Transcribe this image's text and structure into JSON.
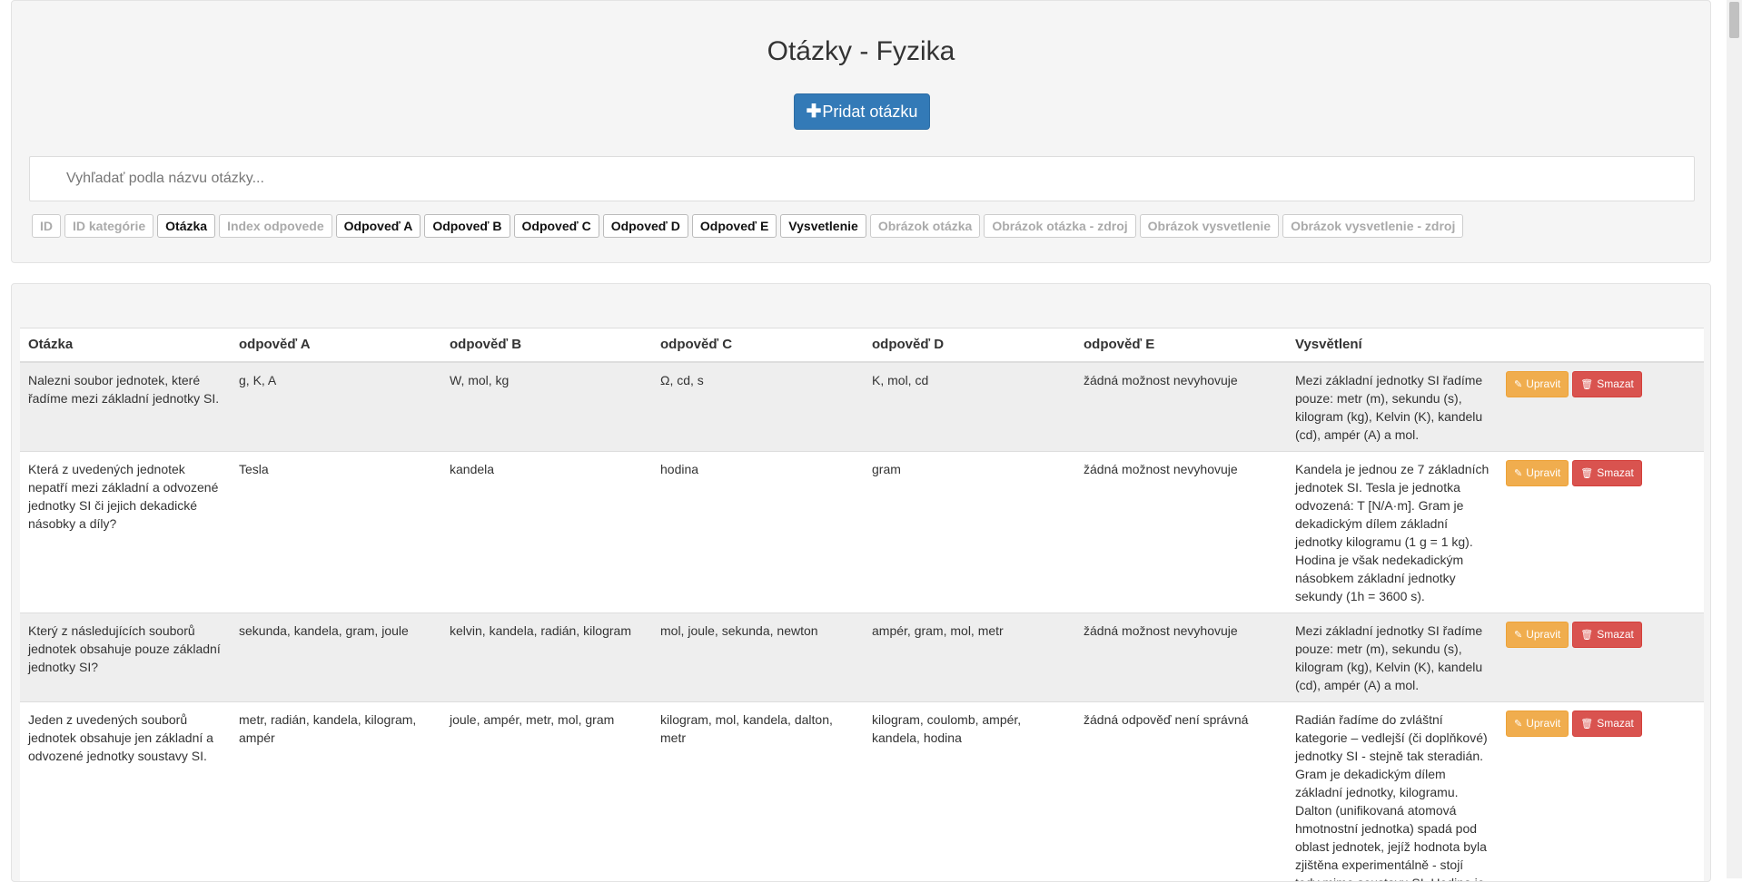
{
  "header": {
    "title": "Otázky - Fyzika",
    "add_button_label": "Pridat otázku",
    "search_placeholder": "Vyhľadať podla názvu otázky..."
  },
  "column_toggles": [
    {
      "label": "ID",
      "active": false
    },
    {
      "label": "ID kategórie",
      "active": false
    },
    {
      "label": "Otázka",
      "active": true
    },
    {
      "label": "Index odpovede",
      "active": false
    },
    {
      "label": "Odpoveď A",
      "active": true
    },
    {
      "label": "Odpoveď B",
      "active": true
    },
    {
      "label": "Odpoveď C",
      "active": true
    },
    {
      "label": "Odpoveď D",
      "active": true
    },
    {
      "label": "Odpoveď E",
      "active": true
    },
    {
      "label": "Vysvetlenie",
      "active": true
    },
    {
      "label": "Obrázok otázka",
      "active": false
    },
    {
      "label": "Obrázok otázka - zdroj",
      "active": false
    },
    {
      "label": "Obrázok vysvetlenie",
      "active": false
    },
    {
      "label": "Obrázok vysvetlenie - zdroj",
      "active": false
    }
  ],
  "table": {
    "headers": [
      "Otázka",
      "odpověď A",
      "odpověď B",
      "odpověď C",
      "odpověď D",
      "odpověď E",
      "Vysvětlení"
    ],
    "edit_label": "Upravit",
    "delete_label": "Smazat",
    "rows": [
      {
        "question": "Nalezni soubor jednotek, které řadíme mezi základní jednotky SI.",
        "a": "g, K, A",
        "b": "W, mol, kg",
        "c": "Ω, cd, s",
        "d": "K, mol, cd",
        "e": "žádná možnost nevyhovuje",
        "explanation": "Mezi základní jednotky SI řadíme pouze: metr (m), sekundu (s), kilogram (kg), Kelvin (K), kandelu (cd), ampér (A) a mol."
      },
      {
        "question": "Která z uvedených jednotek nepatří mezi základní a odvozené jednotky SI či jejich dekadické násobky a díly?",
        "a": "Tesla",
        "b": "kandela",
        "c": "hodina",
        "d": "gram",
        "e": "žádná možnost nevyhovuje",
        "explanation": "Kandela je jednou ze 7 základních jednotek SI. Tesla je jednotka odvozená: T [N/A·m]. Gram je dekadickým dílem základní jednotky kilogramu (1 g = 1 kg). Hodina je však nedekadickým násobkem základní jednotky sekundy (1h = 3600 s)."
      },
      {
        "question": "Který z následujících souborů jednotek obsahuje pouze základní jednotky SI?",
        "a": "sekunda, kandela, gram, joule",
        "b": "kelvin, kandela, radián, kilogram",
        "c": "mol, joule, sekunda, newton",
        "d": "ampér, gram, mol, metr",
        "e": "žádná možnost nevyhovuje",
        "explanation": "Mezi základní jednotky SI řadíme pouze: metr (m), sekundu (s), kilogram (kg), Kelvin (K), kandelu (cd), ampér (A) a mol."
      },
      {
        "question": "Jeden z uvedených souborů jednotek obsahuje jen základní a odvozené jednotky soustavy SI.",
        "a": "metr, radián, kandela, kilogram, ampér",
        "b": "joule, ampér, metr, mol, gram",
        "c": "kilogram, mol, kandela, dalton, metr",
        "d": "kilogram, coulomb, ampér, kandela, hodina",
        "e": "žádná odpověď není správná",
        "explanation": "Radián řadíme do zvláštní kategorie – vedlejší (či doplňkové) jednotky SI - stejně tak steradián. Gram je dekadickým dílem základní jednotky, kilogramu. Dalton (unifikovaná atomová hmotnostní jednotka) spadá pod oblast jednotek, jejíž hodnota byla zjištěna experimentálně - stojí tedy mimo soustavu SI. Hodina je"
      }
    ]
  }
}
